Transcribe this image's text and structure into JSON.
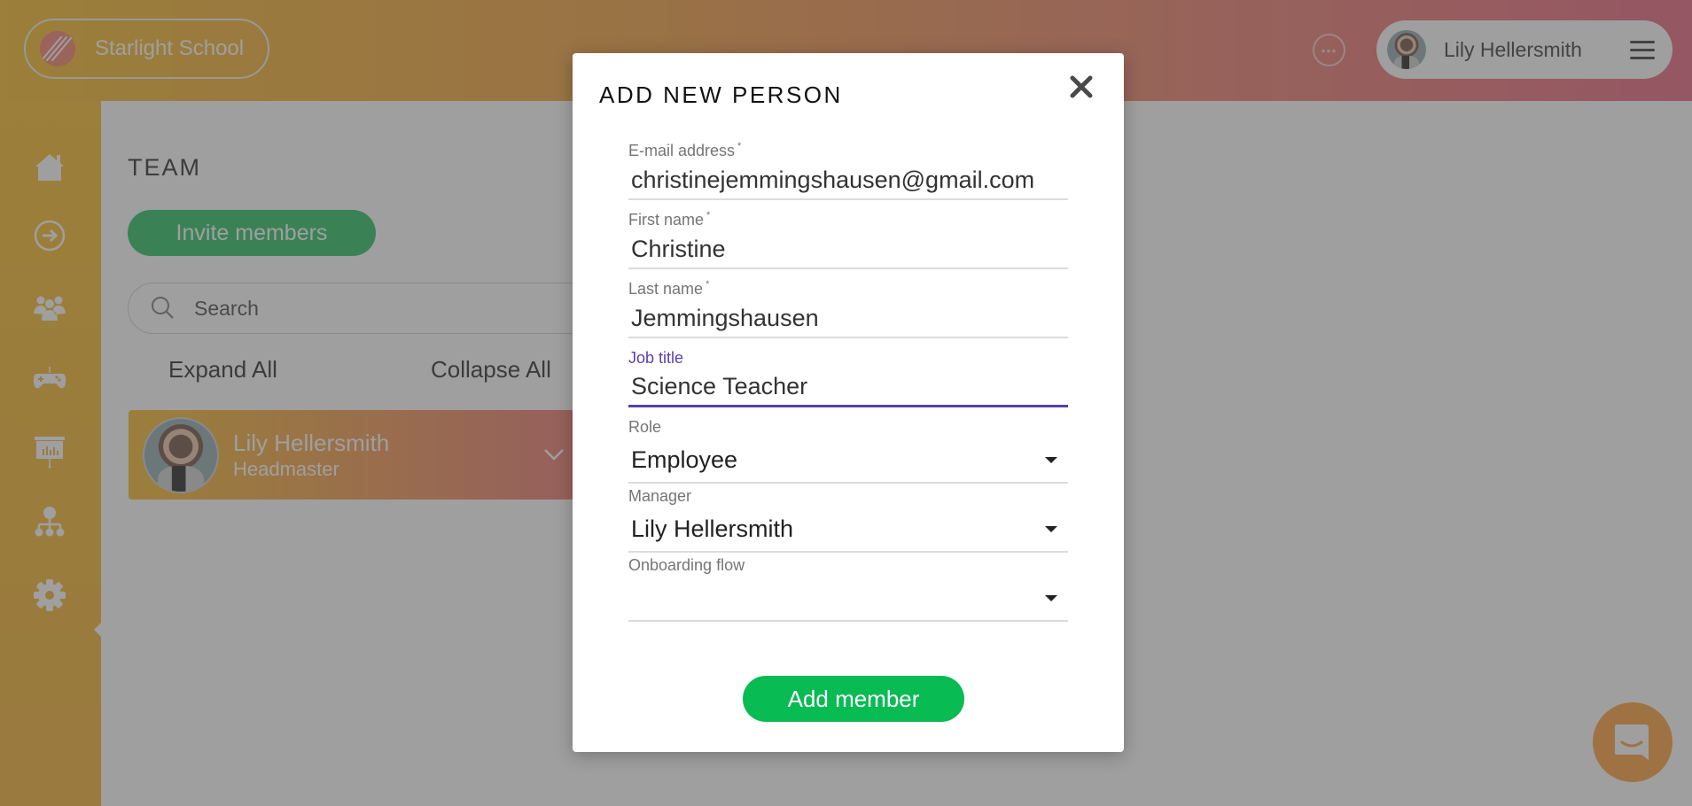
{
  "app": {
    "brand_name": "Starlight School",
    "brand_color": "#f5b81f",
    "accent_color": "#e8607a"
  },
  "header": {
    "user_name": "Lily Hellersmith",
    "more_icon": "ellipsis-icon",
    "menu_icon": "hamburger-icon"
  },
  "sidebar": {
    "items": [
      {
        "icon": "home-icon",
        "label": "Home"
      },
      {
        "icon": "arrow-right-circle-icon",
        "label": "Go"
      },
      {
        "icon": "people-icon",
        "label": "People"
      },
      {
        "icon": "gamepad-icon",
        "label": "Games"
      },
      {
        "icon": "presentation-icon",
        "label": "Presentations"
      },
      {
        "icon": "org-chart-icon",
        "label": "Team",
        "active": true
      },
      {
        "icon": "gear-icon",
        "label": "Settings"
      }
    ]
  },
  "team": {
    "title": "TEAM",
    "invite_label": "Invite members",
    "search_placeholder": "Search",
    "expand_all": "Expand All",
    "collapse_all": "Collapse All",
    "members": [
      {
        "name": "Lily Hellersmith",
        "role": "Headmaster"
      }
    ]
  },
  "modal": {
    "title": "ADD NEW PERSON",
    "fields": {
      "email": {
        "label": "E-mail address",
        "required": "*",
        "value": "christinejemmingshausen@gmail.com"
      },
      "first_name": {
        "label": "First name",
        "required": "*",
        "value": "Christine"
      },
      "last_name": {
        "label": "Last name",
        "required": "*",
        "value": "Jemmingshausen"
      },
      "job_title": {
        "label": "Job title",
        "value": "Science Teacher"
      },
      "role": {
        "label": "Role",
        "value": "Employee"
      },
      "manager": {
        "label": "Manager",
        "value": "Lily Hellersmith"
      },
      "onboarding_flow": {
        "label": "Onboarding flow",
        "value": ""
      }
    },
    "submit_label": "Add member",
    "focus_color": "#5b3fb0",
    "submit_color": "#08bb53"
  },
  "chat_widget": {
    "icon": "chat-smile-icon",
    "color": "#ff9c33"
  }
}
